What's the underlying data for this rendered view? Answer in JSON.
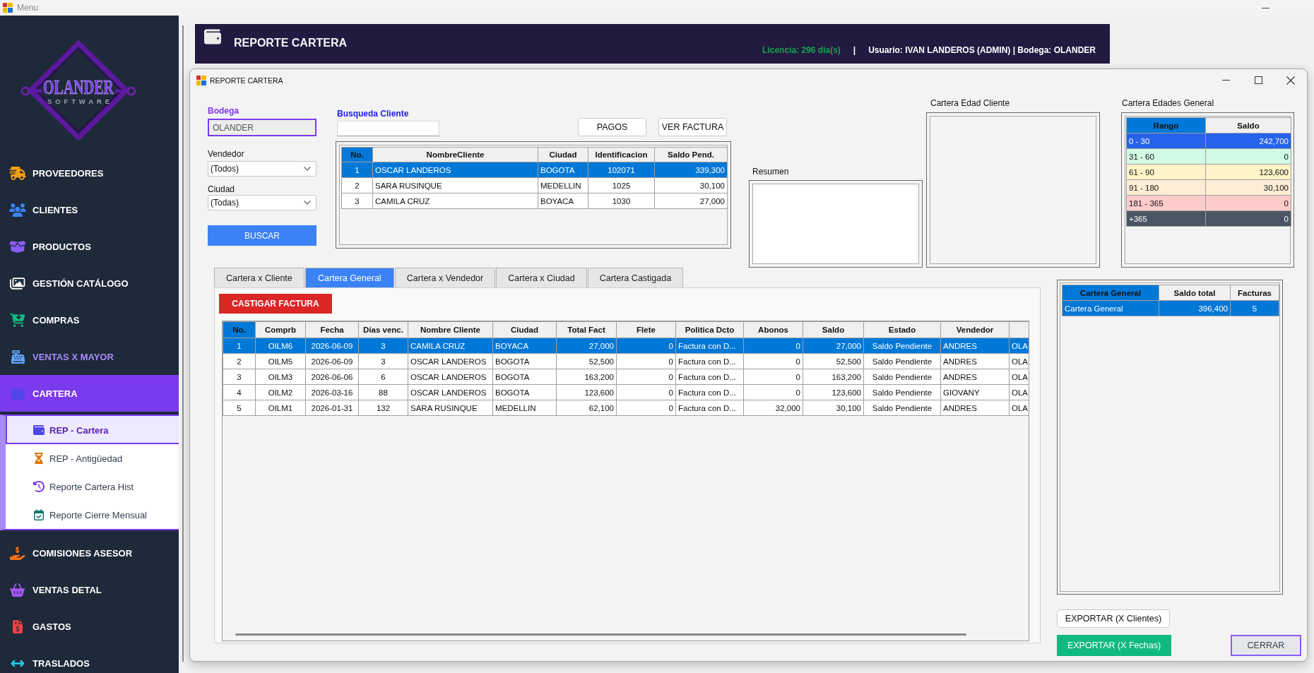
{
  "app_window": {
    "title": "Menu"
  },
  "sidebar": {
    "logo": {
      "name": "OLANDER",
      "tagline": "SOFTWARE"
    },
    "items": [
      {
        "label": "PROVEEDORES",
        "selected": false,
        "highlighted": false
      },
      {
        "label": "CLIENTES",
        "selected": false,
        "highlighted": false
      },
      {
        "label": "PRODUCTOS",
        "selected": false,
        "highlighted": false
      },
      {
        "label": "GESTIÓN CATÁLOGO",
        "selected": false,
        "highlighted": false
      },
      {
        "label": "COMPRAS",
        "selected": false,
        "highlighted": false
      },
      {
        "label": "VENTAS X MAYOR",
        "selected": false,
        "highlighted": true
      },
      {
        "label": "CARTERA",
        "selected": true,
        "highlighted": false,
        "expanded": true,
        "children": [
          {
            "label": "REP - Cartera",
            "selected": true
          },
          {
            "label": "REP - Antigüedad",
            "selected": false
          },
          {
            "label": "Reporte Cartera Hist",
            "selected": false
          },
          {
            "label": "Reporte Cierre Mensual",
            "selected": false
          }
        ]
      },
      {
        "label": "COMISIONES ASESOR",
        "selected": false,
        "highlighted": false
      },
      {
        "label": "VENTAS DETAL",
        "selected": false,
        "highlighted": false
      },
      {
        "label": "GASTOS",
        "selected": false,
        "highlighted": false
      },
      {
        "label": "TRASLADOS",
        "selected": false,
        "highlighted": false
      }
    ]
  },
  "header": {
    "title": "REPORTE CARTERA",
    "license": "Licencia: 296 día(s)",
    "separator": "|",
    "user_info": "Usuario: IVAN LANDEROS (ADMIN) | Bodega: OLANDER"
  },
  "dialog": {
    "title": "REPORTE CARTERA",
    "bodega": {
      "label": "Bodega",
      "value": "OLANDER",
      "disabled": true
    },
    "vendedor": {
      "label": "Vendedor",
      "value": "(Todos)"
    },
    "ciudad": {
      "label": "Ciudad",
      "value": "(Todas)"
    },
    "search_button": "BUSCAR",
    "client_search": {
      "label": "Busqueda Cliente"
    },
    "action_buttons": [
      "PAGOS",
      "VER FACTURA"
    ],
    "clients_table": {
      "columns": [
        {
          "label": "No.",
          "selected": true
        },
        {
          "label": "NombreCliente",
          "selected": false
        },
        {
          "label": "Ciudad",
          "selected": false
        },
        {
          "label": "Identificacion",
          "selected": false
        },
        {
          "label": "Saldo Pend.",
          "selected": false
        }
      ],
      "rows": [
        {
          "selected": true,
          "cells": [
            "1",
            "OSCAR LANDEROS",
            "BOGOTA",
            "102071",
            "339,300"
          ]
        },
        {
          "selected": false,
          "cells": [
            "2",
            "SARA RUSINQUE",
            "MEDELLIN",
            "1025",
            "30,100"
          ]
        },
        {
          "selected": false,
          "cells": [
            "3",
            "CAMILA CRUZ",
            "BOYACA",
            "1030",
            "27,000"
          ]
        }
      ]
    },
    "resumen": {
      "label": "Resumen"
    },
    "edad_cliente": {
      "label": "Cartera Edad Cliente"
    },
    "edades_general": {
      "label": "Cartera Edades General",
      "columns": [
        {
          "label": "Rango",
          "selected": true
        },
        {
          "label": "Saldo",
          "selected": false
        }
      ],
      "rows": [
        {
          "range": "0 - 30",
          "saldo": "242,700",
          "color": "#2563eb"
        },
        {
          "range": "31 - 60",
          "saldo": "0",
          "color": "#d1fae5"
        },
        {
          "range": "61 - 90",
          "saldo": "123,600",
          "color": "#fef3c7"
        },
        {
          "range": "91 - 180",
          "saldo": "30,100",
          "color": "#ffedd5"
        },
        {
          "range": "181 - 365",
          "saldo": "0",
          "color": "#fecaca"
        },
        {
          "range": "+365",
          "saldo": "0",
          "color": "#4b5563"
        }
      ]
    },
    "tabs": [
      {
        "label": "Cartera x Cliente",
        "selected": false
      },
      {
        "label": "Cartera General",
        "selected": true
      },
      {
        "label": "Cartera x Vendedor",
        "selected": false
      },
      {
        "label": "Cartera x Ciudad",
        "selected": false
      },
      {
        "label": "Cartera Castigada",
        "selected": false
      }
    ],
    "castigar_button": "CASTIGAR FACTURA",
    "invoices_table": {
      "columns": [
        {
          "label": "No.",
          "selected": true
        },
        {
          "label": "Comprb",
          "selected": false
        },
        {
          "label": "Fecha",
          "selected": false
        },
        {
          "label": "Días venc.",
          "selected": false
        },
        {
          "label": "Nombre Cliente",
          "selected": false
        },
        {
          "label": "Ciudad",
          "selected": false
        },
        {
          "label": "Total Fact",
          "selected": false
        },
        {
          "label": "Flete",
          "selected": false
        },
        {
          "label": "Politica Dcto",
          "selected": false
        },
        {
          "label": "Abonos",
          "selected": false
        },
        {
          "label": "Saldo",
          "selected": false
        },
        {
          "label": "Estado",
          "selected": false
        },
        {
          "label": "Vendedor",
          "selected": false
        }
      ],
      "rows": [
        {
          "selected": true,
          "cells": [
            "1",
            "OILM6",
            "2026-06-09",
            "3",
            "CAMILA CRUZ",
            "BOYACA",
            "27,000",
            "0",
            "Factura con D...",
            "0",
            "27,000",
            "Saldo Pendiente",
            "ANDRES",
            "OLA"
          ]
        },
        {
          "selected": false,
          "cells": [
            "2",
            "OILM5",
            "2026-06-09",
            "3",
            "OSCAR LANDEROS",
            "BOGOTA",
            "52,500",
            "0",
            "Factura con D...",
            "0",
            "52,500",
            "Saldo Pendiente",
            "ANDRES",
            "OLA"
          ]
        },
        {
          "selected": false,
          "cells": [
            "3",
            "OILM3",
            "2026-06-06",
            "6",
            "OSCAR LANDEROS",
            "BOGOTA",
            "163,200",
            "0",
            "Factura con D...",
            "0",
            "163,200",
            "Saldo Pendiente",
            "ANDRES",
            "OLA"
          ]
        },
        {
          "selected": false,
          "cells": [
            "4",
            "OILM2",
            "2026-03-16",
            "88",
            "OSCAR LANDEROS",
            "BOGOTA",
            "123,600",
            "0",
            "Factura con D...",
            "0",
            "123,600",
            "Saldo Pendiente",
            "GIOVANY",
            "OLA"
          ]
        },
        {
          "selected": false,
          "cells": [
            "5",
            "OILM1",
            "2026-01-31",
            "132",
            "SARA RUSINQUE",
            "MEDELLIN",
            "62,100",
            "0",
            "Factura con D...",
            "32,000",
            "30,100",
            "Saldo Pendiente",
            "ANDRES",
            "OLA"
          ]
        }
      ]
    },
    "summary_table": {
      "columns": [
        {
          "label": "Cartera General",
          "selected": true
        },
        {
          "label": "Saldo total",
          "selected": false
        },
        {
          "label": "Facturas",
          "selected": false
        }
      ],
      "rows": [
        {
          "selected": true,
          "cells": [
            "Cartera General",
            "396,400",
            "5"
          ]
        }
      ]
    },
    "export_buttons": [
      {
        "label": "EXPORTAR (X Clientes)",
        "kind": "outline"
      },
      {
        "label": "EXPORTAR (X Fechas)",
        "kind": "success"
      }
    ],
    "close_button": "CERRAR"
  }
}
